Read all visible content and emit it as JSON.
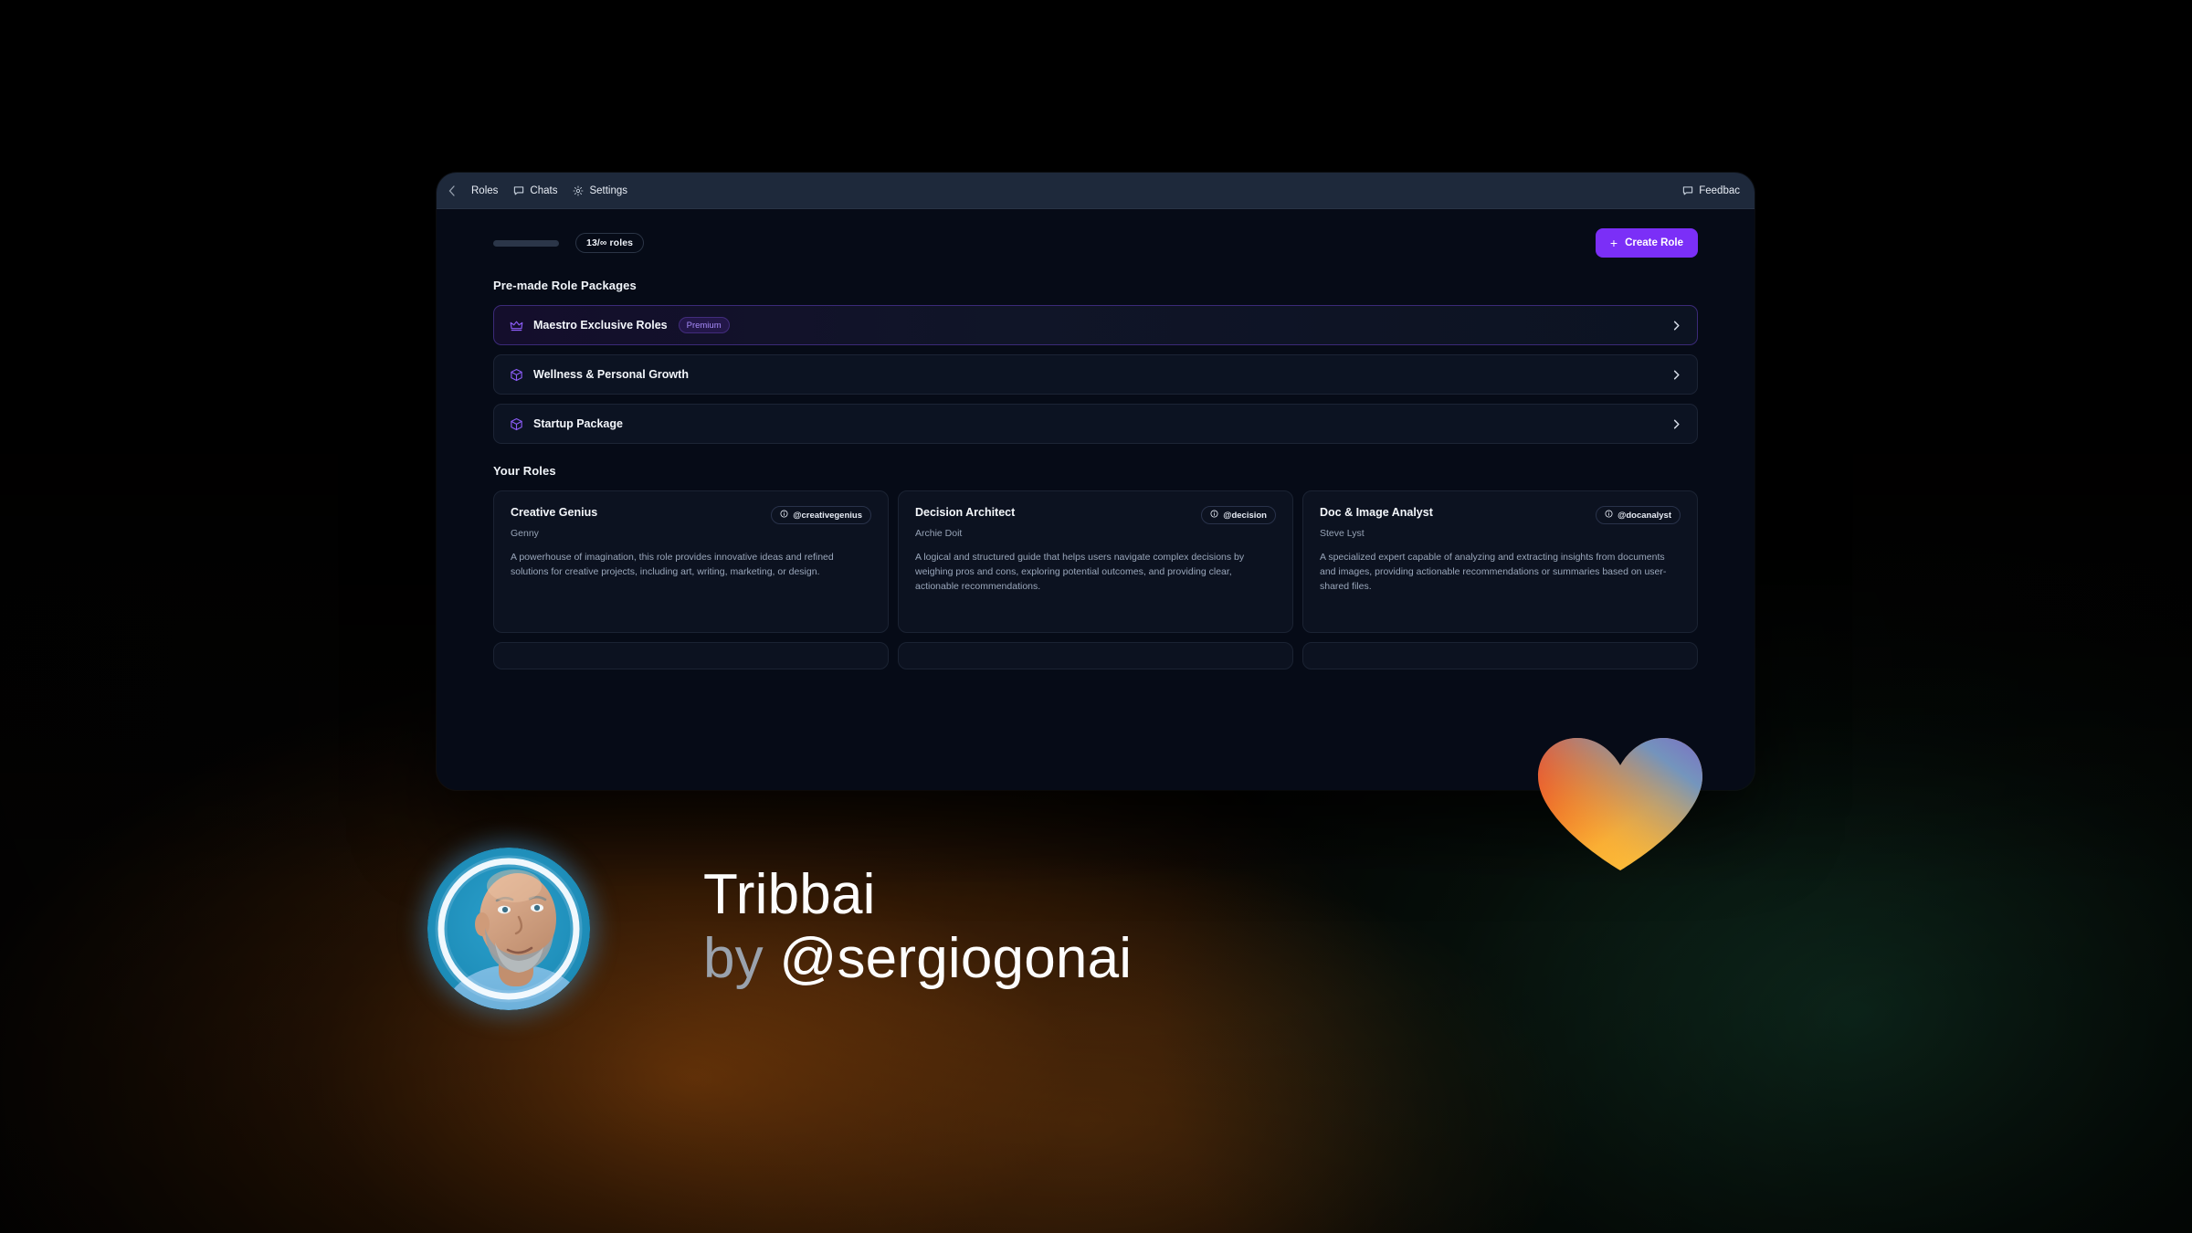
{
  "window": {
    "navbar": {
      "items": [
        {
          "label": "Roles",
          "icon": "back-chevron-icon"
        },
        {
          "label": "Chats",
          "icon": "chat-bubble-icon"
        },
        {
          "label": "Settings",
          "icon": "gear-icon"
        }
      ],
      "feedback": {
        "label": "Feedbac",
        "icon": "chat-bubble-icon"
      }
    },
    "toolbar": {
      "roles_badge": "13/∞ roles",
      "create_label": "Create Role",
      "plus": "+",
      "accent_color": "#7b2ff7"
    },
    "premade": {
      "title": "Pre-made Role Packages",
      "packages": [
        {
          "label": "Maestro Exclusive Roles",
          "badge": "Premium",
          "icon": "crown-icon",
          "premium": true
        },
        {
          "label": "Wellness & Personal Growth",
          "badge": "",
          "icon": "package-box-icon",
          "premium": false
        },
        {
          "label": "Startup Package",
          "badge": "",
          "icon": "package-box-icon",
          "premium": false
        }
      ]
    },
    "your_roles": {
      "title": "Your Roles",
      "cards": [
        {
          "title": "Creative Genius",
          "handle": "@creativegenius",
          "persona": "Genny",
          "description": "A powerhouse of imagination, this role provides innovative ideas and refined solutions for creative projects, including art, writing, marketing, or design."
        },
        {
          "title": "Decision Architect",
          "handle": "@decision",
          "persona": "Archie Doit",
          "description": "A logical and structured guide that helps users navigate complex decisions by weighing pros and cons, exploring potential outcomes, and providing clear, actionable recommendations."
        },
        {
          "title": "Doc & Image Analyst",
          "handle": "@docanalyst",
          "persona": "Steve Lyst",
          "description": "A specialized expert capable of analyzing and extracting insights from documents and images, providing actionable recommendations or summaries based on user-shared files."
        }
      ]
    }
  },
  "branding": {
    "product": "Tribbai",
    "by": "by",
    "handle": "@sergiogonai",
    "avatar_alt": "author-portrait",
    "heart_alt": "gradient-heart"
  }
}
